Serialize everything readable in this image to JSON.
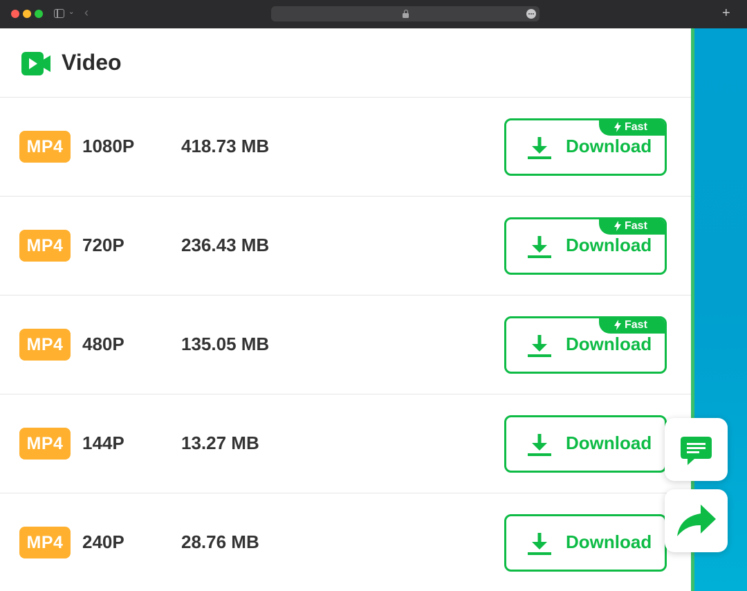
{
  "header": {
    "title": "Video",
    "icon": "video-play-icon"
  },
  "colors": {
    "accent": "#0dbb45",
    "badge": "#ffb02e"
  },
  "rows": [
    {
      "format": "MP4",
      "quality": "1080P",
      "size": "418.73 MB",
      "button_label": "Download",
      "fast": "Fast"
    },
    {
      "format": "MP4",
      "quality": "720P",
      "size": "236.43 MB",
      "button_label": "Download",
      "fast": "Fast"
    },
    {
      "format": "MP4",
      "quality": "480P",
      "size": "135.05 MB",
      "button_label": "Download",
      "fast": "Fast"
    },
    {
      "format": "MP4",
      "quality": "144P",
      "size": "13.27 MB",
      "button_label": "Download"
    },
    {
      "format": "MP4",
      "quality": "240P",
      "size": "28.76 MB",
      "button_label": "Download"
    }
  ],
  "floating": {
    "chat_icon": "chat-icon",
    "share_icon": "share-icon"
  }
}
